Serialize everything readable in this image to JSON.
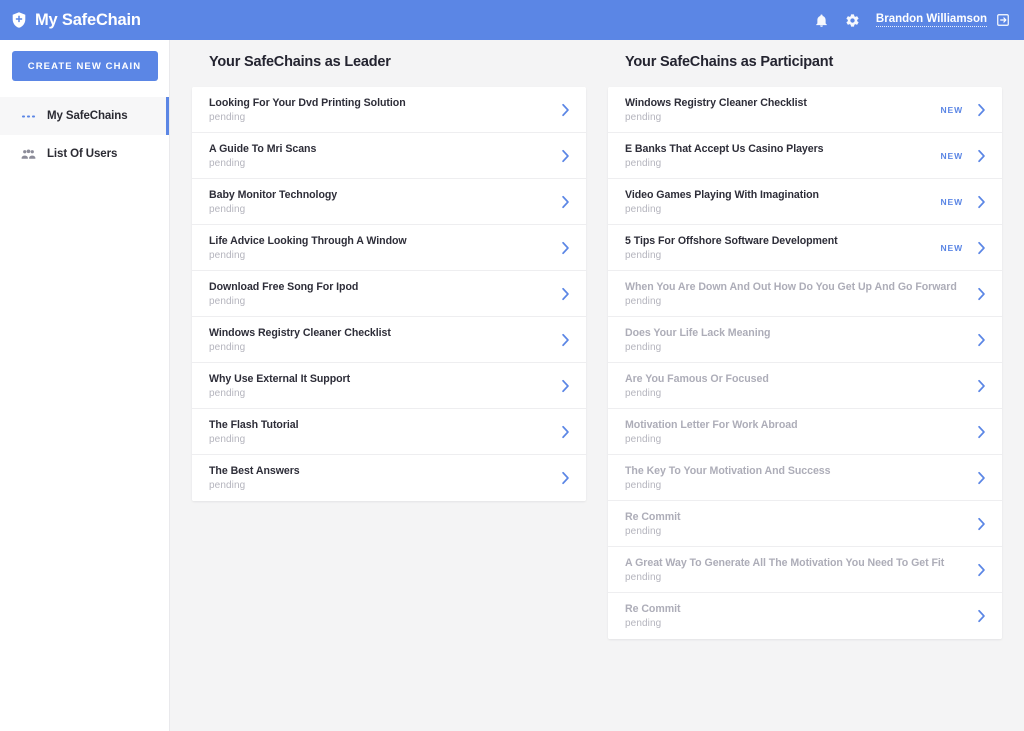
{
  "header": {
    "logo_icon": "shield-icon",
    "title": "My SafeChain",
    "notifications_icon": "bell-icon",
    "settings_icon": "gear-icon",
    "user_name": "Brandon Williamson",
    "logout_icon": "logout-icon",
    "background_color": "#5b86e5"
  },
  "sidebar": {
    "create_button": "CREATE NEW CHAIN",
    "items": [
      {
        "label": "My SafeChains",
        "icon": "chain-dots-icon",
        "active": true
      },
      {
        "label": "List Of Users",
        "icon": "users-group-icon",
        "active": false
      }
    ]
  },
  "columns": [
    {
      "title": "Your SafeChains as Leader",
      "rows": [
        {
          "title": "Looking For Your Dvd Printing Solution",
          "status": "pending",
          "badge": "",
          "faded": false
        },
        {
          "title": "A Guide To Mri Scans",
          "status": "pending",
          "badge": "",
          "faded": false
        },
        {
          "title": "Baby Monitor Technology",
          "status": "pending",
          "badge": "",
          "faded": false
        },
        {
          "title": "Life Advice Looking Through A Window",
          "status": "pending",
          "badge": "",
          "faded": false
        },
        {
          "title": "Download Free Song For Ipod",
          "status": "pending",
          "badge": "",
          "faded": false
        },
        {
          "title": "Windows Registry Cleaner Checklist",
          "status": "pending",
          "badge": "",
          "faded": false
        },
        {
          "title": "Why Use External It Support",
          "status": "pending",
          "badge": "",
          "faded": false
        },
        {
          "title": "The Flash Tutorial",
          "status": "pending",
          "badge": "",
          "faded": false
        },
        {
          "title": "The Best Answers",
          "status": "pending",
          "badge": "",
          "faded": false
        }
      ]
    },
    {
      "title": "Your SafeChains as Participant",
      "rows": [
        {
          "title": "Windows Registry Cleaner Checklist",
          "status": "pending",
          "badge": "NEW",
          "faded": false
        },
        {
          "title": "E Banks That Accept Us Casino Players",
          "status": "pending",
          "badge": "NEW",
          "faded": false
        },
        {
          "title": "Video Games Playing With Imagination",
          "status": "pending",
          "badge": "NEW",
          "faded": false
        },
        {
          "title": "5 Tips For Offshore Software Development",
          "status": "pending",
          "badge": "NEW",
          "faded": false
        },
        {
          "title": "When You Are Down And Out How Do You Get Up And Go Forward",
          "status": "pending",
          "badge": "",
          "faded": true
        },
        {
          "title": "Does Your Life Lack Meaning",
          "status": "pending",
          "badge": "",
          "faded": true
        },
        {
          "title": "Are You Famous Or Focused",
          "status": "pending",
          "badge": "",
          "faded": true
        },
        {
          "title": "Motivation Letter For Work Abroad",
          "status": "pending",
          "badge": "",
          "faded": true
        },
        {
          "title": "The Key To Your Motivation And Success",
          "status": "pending",
          "badge": "",
          "faded": true
        },
        {
          "title": "Re Commit",
          "status": "pending",
          "badge": "",
          "faded": true
        },
        {
          "title": "A Great Way To Generate All The Motivation You Need To Get Fit",
          "status": "pending",
          "badge": "",
          "faded": true
        },
        {
          "title": "Re Commit",
          "status": "pending",
          "badge": "",
          "faded": true
        }
      ]
    }
  ],
  "theme": {
    "accent": "#5b86e5",
    "page_background": "#f4f4f5",
    "card_background": "#ffffff",
    "muted_text": "#b4b4bd"
  }
}
